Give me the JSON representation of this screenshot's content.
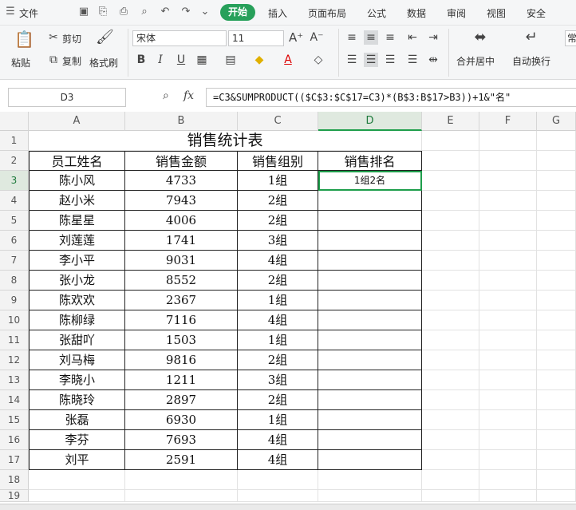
{
  "menu": {
    "file": "文件",
    "active_tab": "开始",
    "tabs": [
      "插入",
      "页面布局",
      "公式",
      "数据",
      "审阅",
      "视图",
      "安全"
    ]
  },
  "ribbon": {
    "paste": "粘贴",
    "cut": "剪切",
    "copy": "复制",
    "format_painter": "格式刷",
    "font_name": "宋体",
    "font_size": "11",
    "merge_center": "合并居中",
    "wrap_text": "自动换行",
    "overflow_label": "常"
  },
  "formula_bar": {
    "name_box": "D3",
    "fx": "fx",
    "formula": "=C3&SUMPRODUCT(($C$3:$C$17=C3)*(B$3:B$17>B3))+1&\"名\""
  },
  "columns": [
    "A",
    "B",
    "C",
    "D",
    "E",
    "F",
    "G"
  ],
  "rows": [
    "1",
    "2",
    "3",
    "4",
    "5",
    "6",
    "7",
    "8",
    "9",
    "10",
    "11",
    "12",
    "13",
    "14",
    "15",
    "16",
    "17",
    "18",
    "19"
  ],
  "sheet": {
    "title": "销售统计表",
    "headers": [
      "员工姓名",
      "销售金额",
      "销售组别",
      "销售排名"
    ],
    "data": [
      [
        "陈小风",
        "4733",
        "1组",
        "1组2名"
      ],
      [
        "赵小米",
        "7943",
        "2组",
        ""
      ],
      [
        "陈星星",
        "4006",
        "2组",
        ""
      ],
      [
        "刘莲莲",
        "1741",
        "3组",
        ""
      ],
      [
        "李小平",
        "9031",
        "4组",
        ""
      ],
      [
        "张小龙",
        "8552",
        "2组",
        ""
      ],
      [
        "陈欢欢",
        "2367",
        "1组",
        ""
      ],
      [
        "陈柳绿",
        "7116",
        "4组",
        ""
      ],
      [
        "张甜吖",
        "1503",
        "1组",
        ""
      ],
      [
        "刘马梅",
        "9816",
        "2组",
        ""
      ],
      [
        "李晓小",
        "1211",
        "3组",
        ""
      ],
      [
        "陈晓玲",
        "2897",
        "2组",
        ""
      ],
      [
        "张磊",
        "6930",
        "1组",
        ""
      ],
      [
        "李芬",
        "7693",
        "4组",
        ""
      ],
      [
        "刘平",
        "2591",
        "4组",
        ""
      ]
    ]
  },
  "colors": {
    "accent": "#27a05a",
    "selection": "#1e9e4b"
  }
}
